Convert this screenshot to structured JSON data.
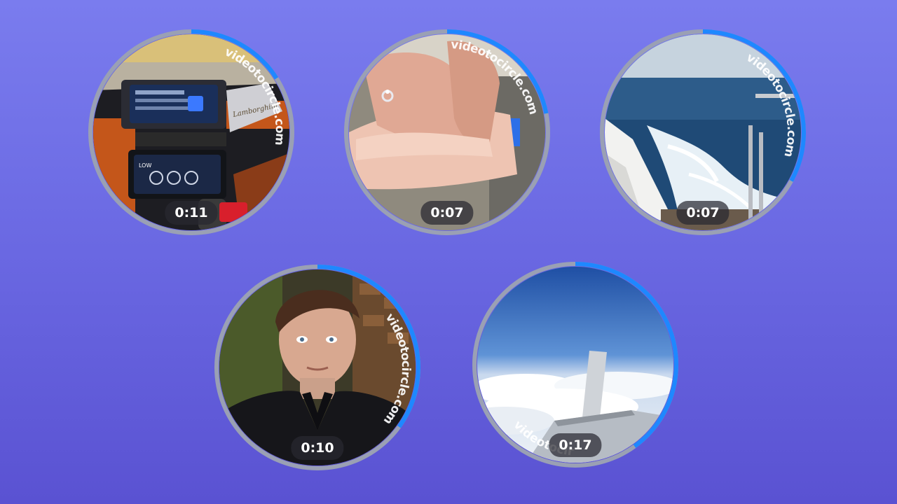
{
  "videos": [
    {
      "duration": "0:11",
      "watermark": "videotocircle.com",
      "progress": 0.16,
      "scene": "car-interior-icon",
      "car_badge": "Lamborghini",
      "screen_button": "LOW"
    },
    {
      "duration": "0:07",
      "watermark": "videotocircle.com",
      "progress": 0.22,
      "scene": "hands-ring-icon"
    },
    {
      "duration": "0:07",
      "watermark": "videotocircle.com",
      "progress": 0.33,
      "scene": "sea-wake-icon"
    },
    {
      "duration": "0:10",
      "watermark": "videotocircle.com",
      "progress": 0.35,
      "scene": "portrait-man-icon"
    },
    {
      "duration": "0:17",
      "watermark": "videotocircle.com",
      "progress": 0.4,
      "scene": "airplane-wing-clouds-icon"
    }
  ],
  "colors": {
    "background_top": "#7a7cee",
    "background_bottom": "#5a52d2",
    "ring_track": "#9aa0b4",
    "ring_progress": "#1e88ff"
  }
}
